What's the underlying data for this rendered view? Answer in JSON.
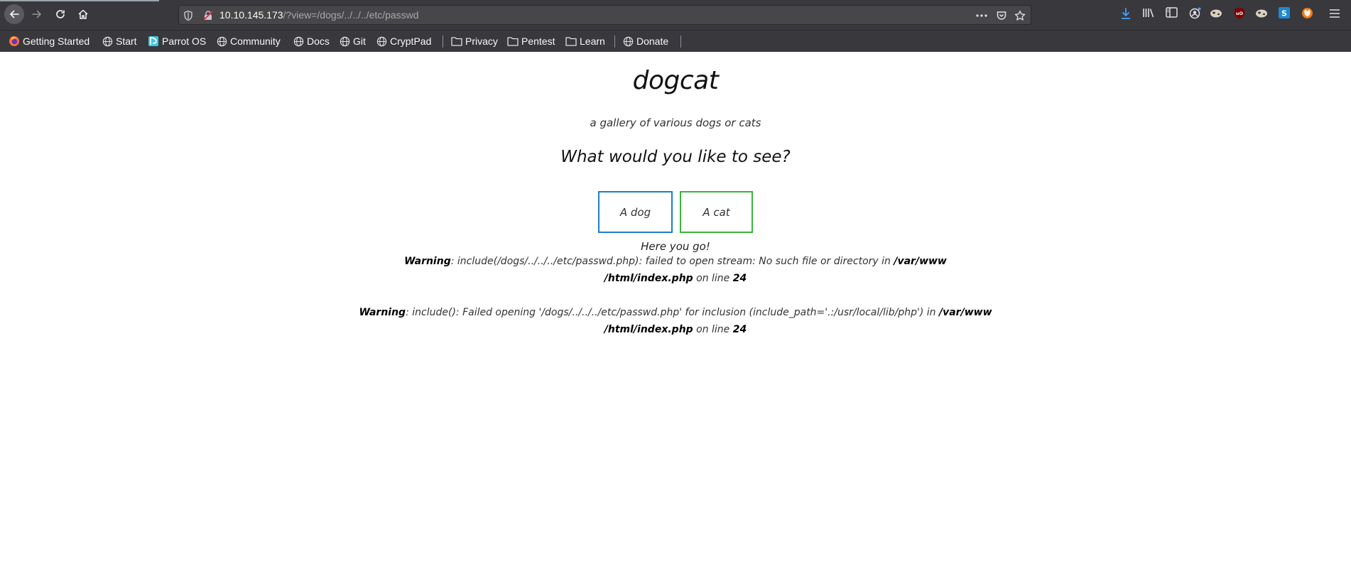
{
  "browser": {
    "url_host": "10.10.145.173",
    "url_path": "/?view=/dogs/../../../etc/passwd",
    "bookmarks": [
      {
        "label": "Getting Started",
        "icon": "firefox-icon"
      },
      {
        "label": "Start",
        "icon": "globe-icon"
      },
      {
        "label": "Parrot OS",
        "icon": "parrot-icon"
      },
      {
        "label": "Community",
        "icon": "globe-icon"
      },
      {
        "label": "Docs",
        "icon": "globe-icon"
      },
      {
        "label": "Git",
        "icon": "globe-icon"
      },
      {
        "label": "CryptPad",
        "icon": "globe-icon"
      },
      {
        "label": "Privacy",
        "icon": "folder-icon"
      },
      {
        "label": "Pentest",
        "icon": "folder-icon"
      },
      {
        "label": "Learn",
        "icon": "folder-icon"
      },
      {
        "label": "Donate",
        "icon": "globe-icon"
      }
    ]
  },
  "page": {
    "title": "dogcat",
    "subtitle": "a gallery of various dogs or cats",
    "question": "What would you like to see?",
    "dog_button": "A dog",
    "cat_button": "A cat",
    "result": "Here you go!",
    "warnings": [
      {
        "label": "Warning",
        "text": ": include(/dogs/../../../etc/passwd.php): failed to open stream: No such file or directory in",
        "path1": "/var/www",
        "path2": "/html/index.php",
        "line_text": "on line",
        "line": "24"
      },
      {
        "label": "Warning",
        "text": ": include(): Failed opening '/dogs/../../../etc/passwd.php' for inclusion (include_path='.:/usr/local/lib/php') in",
        "path1": "/var/www",
        "path2": "/html/index.php",
        "line_text": "on line",
        "line": "24"
      }
    ]
  },
  "colors": {
    "chrome": "#38383d",
    "dog_border": "#1f7fc6",
    "cat_border": "#39b33b",
    "download_blue": "#45a1ff"
  }
}
